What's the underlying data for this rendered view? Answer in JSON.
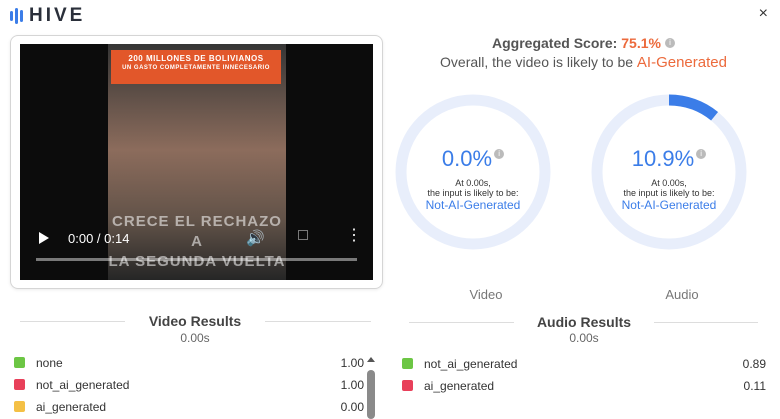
{
  "app": {
    "name": "HIVE",
    "close": "×"
  },
  "video": {
    "banner_line1": "200 MILLONES DE BOLIVIANOS",
    "banner_line2": "UN GASTO COMPLETAMENTE INNECESARIO",
    "overlay_line1": "CRECE EL RECHAZO A",
    "overlay_line2": "LA SEGUNDA VUELTA",
    "time": "0:00 / 0:14",
    "progress": 0
  },
  "summary": {
    "label": "Aggregated Score:",
    "score": "75.1%",
    "subtitle": "Overall, the video is likely to be",
    "verdict": "AI-Generated"
  },
  "gauges": [
    {
      "name": "Video",
      "value": "0.0%",
      "fraction": 0.0,
      "at": "At 0.00s,",
      "likely": "the input is likely to be:",
      "prediction": "Not-AI-Generated"
    },
    {
      "name": "Audio",
      "value": "10.9%",
      "fraction": 0.109,
      "at": "At 0.00s,",
      "likely": "the input is likely to be:",
      "prediction": "Not-AI-Generated"
    }
  ],
  "video_results": {
    "title": "Video Results",
    "time": "0.00s",
    "rows": [
      {
        "label": "none",
        "value": "1.00",
        "color": "#6cc644"
      },
      {
        "label": "not_ai_generated",
        "value": "1.00",
        "color": "#e8405a"
      },
      {
        "label": "ai_generated",
        "value": "0.00",
        "color": "#f4c045"
      }
    ]
  },
  "audio_results": {
    "title": "Audio Results",
    "time": "0.00s",
    "rows": [
      {
        "label": "not_ai_generated",
        "value": "0.89",
        "color": "#6cc644"
      },
      {
        "label": "ai_generated",
        "value": "0.11",
        "color": "#e8405a"
      }
    ]
  },
  "colors": {
    "accent": "#3b7de8",
    "warning": "#ec6a3c",
    "ring_track": "#e8eefb"
  }
}
